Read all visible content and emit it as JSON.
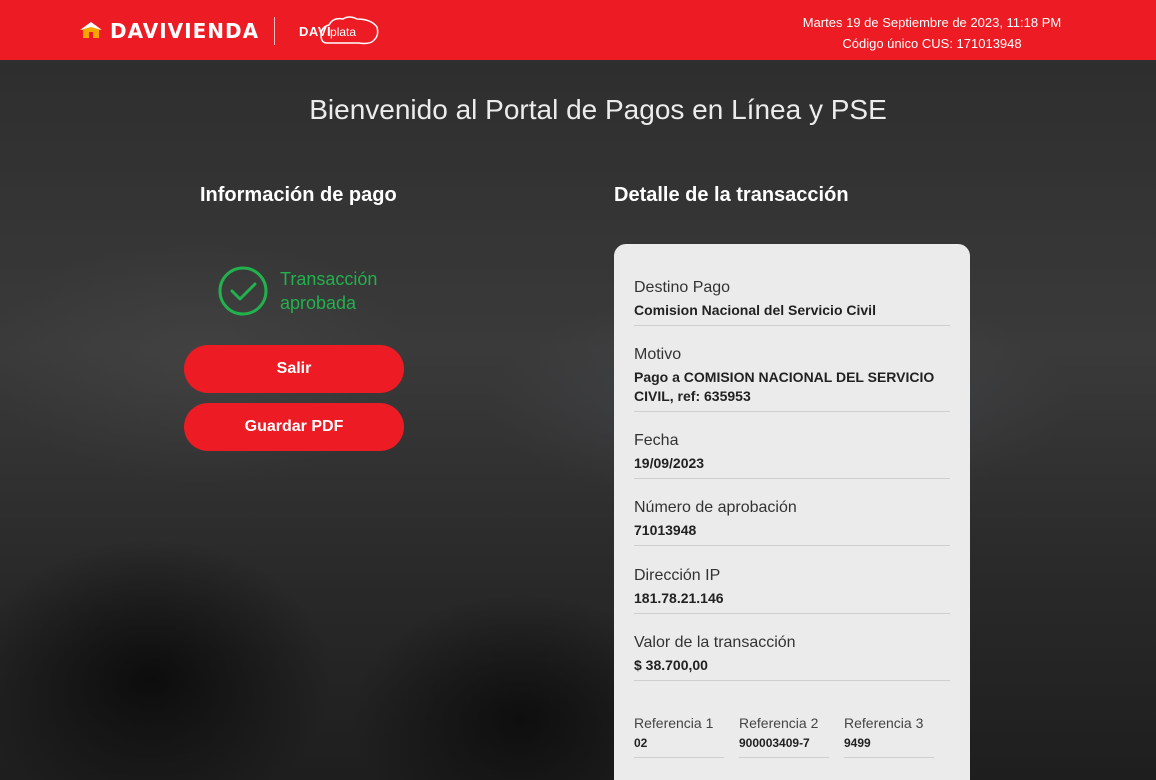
{
  "header": {
    "brand": "DAVIVIENDA",
    "daviplata_davi": "DAVI",
    "daviplata_plata": "plata",
    "datetime": "Martes 19 de Septiembre de 2023, 11:18 PM",
    "cus": "Código único CUS: 171013948",
    "brand_color": "#ed1c24"
  },
  "main": {
    "title": "Bienvenido al Portal de Pagos en Línea y PSE",
    "left_title": "Información de pago",
    "right_title": "Detalle de la transacción",
    "status_text": "Transacción aprobada",
    "status_color": "#22b14c",
    "status_icon": "check-circle-icon",
    "buttons": {
      "exit": "Salir",
      "save_pdf": "Guardar PDF"
    }
  },
  "details": {
    "destino_label": "Destino Pago",
    "destino_value": "Comision Nacional del Servicio Civil",
    "motivo_label": "Motivo",
    "motivo_value": "Pago a COMISION NACIONAL DEL SERVICIO CIVIL, ref: 635953",
    "fecha_label": "Fecha",
    "fecha_value": "19/09/2023",
    "aprobacion_label": "Número de aprobación",
    "aprobacion_value": "71013948",
    "ip_label": "Dirección IP",
    "ip_value": "181.78.21.146",
    "valor_label": "Valor de la transacción",
    "valor_value": "$ 38.700,00",
    "ref1_label": "Referencia 1",
    "ref1_value": "02",
    "ref2_label": "Referencia 2",
    "ref2_value": "900003409-7",
    "ref3_label": "Referencia 3",
    "ref3_value": "9499"
  }
}
